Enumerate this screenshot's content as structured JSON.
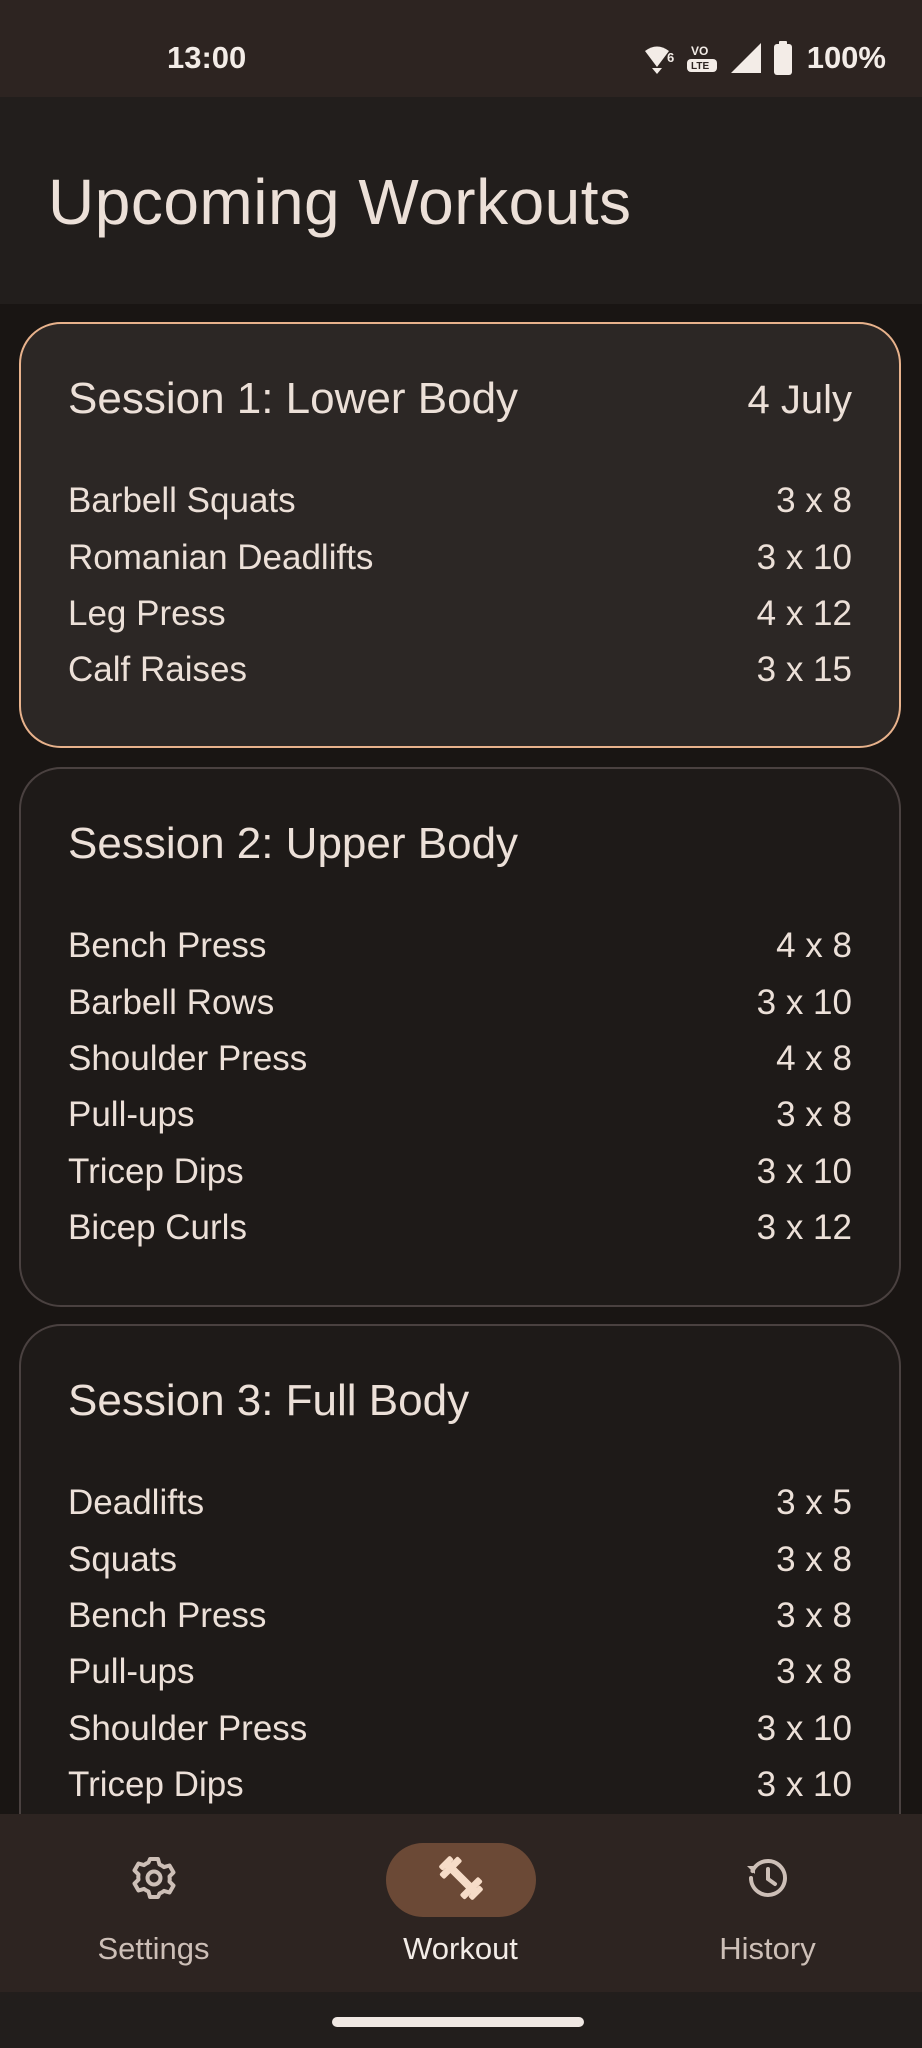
{
  "status": {
    "time": "13:00",
    "battery_pct": "100%",
    "icons": [
      "wifi-6-icon",
      "volte-icon",
      "cell-signal-icon",
      "battery-icon"
    ]
  },
  "header": {
    "title": "Upcoming Workouts"
  },
  "sessions": [
    {
      "title": "Session 1: Lower Body",
      "date": "4 July",
      "exercises": [
        {
          "name": "Barbell Squats",
          "sets": "3 x 8"
        },
        {
          "name": "Romanian Deadlifts",
          "sets": "3 x 10"
        },
        {
          "name": "Leg Press",
          "sets": "4 x 12"
        },
        {
          "name": "Calf Raises",
          "sets": "3 x 15"
        }
      ]
    },
    {
      "title": "Session 2: Upper Body",
      "date": "",
      "exercises": [
        {
          "name": "Bench Press",
          "sets": "4 x 8"
        },
        {
          "name": "Barbell Rows",
          "sets": "3 x 10"
        },
        {
          "name": "Shoulder Press",
          "sets": "4 x 8"
        },
        {
          "name": "Pull-ups",
          "sets": "3 x 8"
        },
        {
          "name": "Tricep Dips",
          "sets": "3 x 10"
        },
        {
          "name": "Bicep Curls",
          "sets": "3 x 12"
        }
      ]
    },
    {
      "title": "Session 3: Full Body",
      "date": "",
      "exercises": [
        {
          "name": "Deadlifts",
          "sets": "3 x 5"
        },
        {
          "name": "Squats",
          "sets": "3 x 8"
        },
        {
          "name": "Bench Press",
          "sets": "3 x 8"
        },
        {
          "name": "Pull-ups",
          "sets": "3 x 8"
        },
        {
          "name": "Shoulder Press",
          "sets": "3 x 10"
        },
        {
          "name": "Tricep Dips",
          "sets": "3 x 10"
        }
      ]
    }
  ],
  "nav": {
    "items": [
      {
        "label": "Settings",
        "icon": "gear-icon"
      },
      {
        "label": "Workout",
        "icon": "dumbbell-icon",
        "selected": true
      },
      {
        "label": "History",
        "icon": "history-icon"
      }
    ]
  },
  "colors": {
    "accent_border": "#e8b28c",
    "selected_pill": "#6b4936",
    "background": "#191513"
  }
}
